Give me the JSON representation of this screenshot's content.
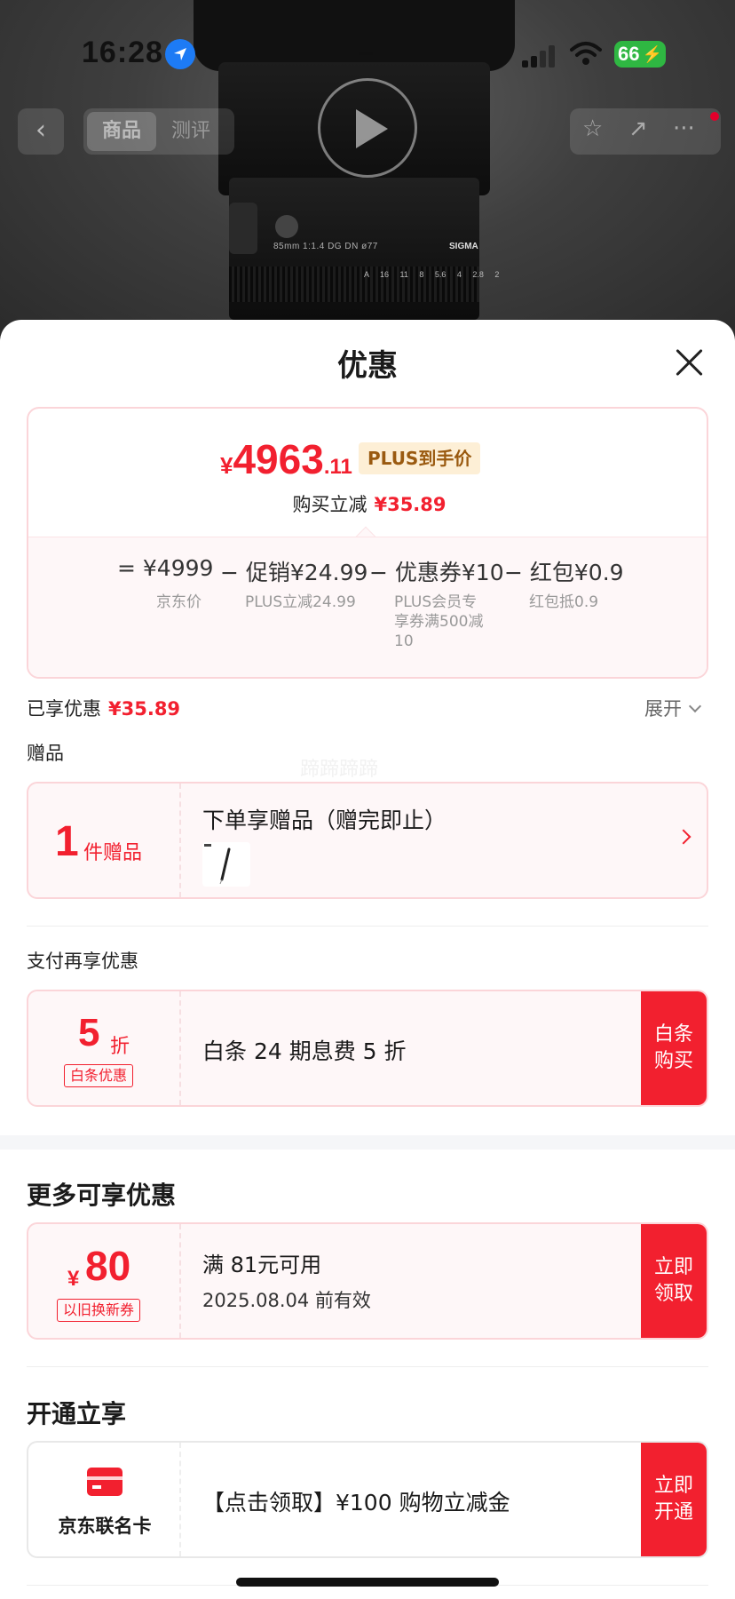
{
  "status_bar": {
    "time": "16:28",
    "battery": "66"
  },
  "nav": {
    "back": "‹",
    "tabs": [
      "商品",
      "测评"
    ],
    "star": "☆",
    "share": "↗",
    "more": "···"
  },
  "product_image": {
    "spec": "85mm 1:1.4 DG DN ø77",
    "brand": "SIGMA",
    "scale": "A 16 11 8 5.6 4 2.8 2"
  },
  "sheet": {
    "title": "优惠",
    "price_summary": {
      "currency": "¥",
      "price_int": "4963",
      "price_dec": ".11",
      "plus_tag": "PLUS到手价",
      "reduce_label": "购买立减",
      "reduce_value": "¥35.89",
      "formula": [
        {
          "op": "=",
          "label": "¥4999",
          "desc": "京东价"
        },
        {
          "op": "−",
          "label": "促销¥24.99",
          "desc": "PLUS立减24.99"
        },
        {
          "op": "−",
          "label": "优惠券¥10",
          "desc": "PLUS会员专享券满500减10"
        },
        {
          "op": "−",
          "label": "红包¥0.9",
          "desc": "红包抵0.9"
        }
      ]
    },
    "enjoyed_label": "已享优惠",
    "enjoyed_value": "¥35.89",
    "expand_label": "展开",
    "gift_section_label": "赠品",
    "watermark": "蹄蹄蹄蹄",
    "gift": {
      "count": "1",
      "unit": "件赠品",
      "title": "下单享赠品（赠完即止）"
    },
    "pay_section_label": "支付再享优惠",
    "pay_discount": {
      "num": "5",
      "unit": "折",
      "tag": "白条优惠",
      "text": "白条 24 期息费 5 折",
      "action": "白条\n购买"
    },
    "more_section_label": "更多可享优惠",
    "coupon": {
      "currency": "¥",
      "amount": "80",
      "tag": "以旧换新券",
      "condition": "满 81元可用",
      "expiry": "2025.08.04 前有效",
      "action": "立即\n领取"
    },
    "open_section_label": "开通立享",
    "card": {
      "name": "京东联名卡",
      "text": "【点击领取】¥100 购物立减金",
      "action": "立即\n开通"
    }
  },
  "colors": {
    "accent": "#f2202f",
    "card_border": "#fbd5d9",
    "card_bg": "#fef7f8",
    "plus_bg": "#fdefd6"
  }
}
